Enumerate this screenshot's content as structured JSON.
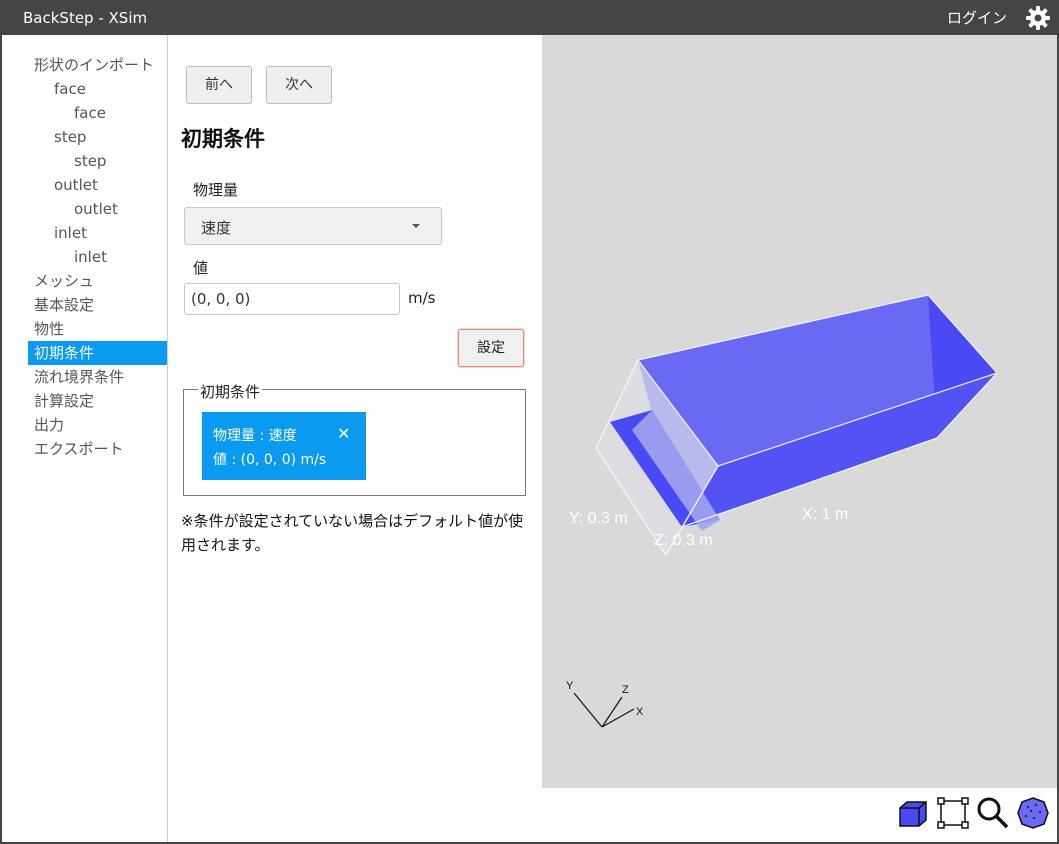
{
  "titlebar": {
    "title": "BackStep - XSim",
    "login": "ログイン"
  },
  "sidebar": {
    "items": [
      {
        "label": "形状のインポート",
        "level": 0,
        "active": false
      },
      {
        "label": "face",
        "level": 1,
        "active": false
      },
      {
        "label": "face",
        "level": 2,
        "active": false
      },
      {
        "label": "step",
        "level": 1,
        "active": false
      },
      {
        "label": "step",
        "level": 2,
        "active": false
      },
      {
        "label": "outlet",
        "level": 1,
        "active": false
      },
      {
        "label": "outlet",
        "level": 2,
        "active": false
      },
      {
        "label": "inlet",
        "level": 1,
        "active": false
      },
      {
        "label": "inlet",
        "level": 2,
        "active": false
      },
      {
        "label": "メッシュ",
        "level": 0,
        "active": false
      },
      {
        "label": "基本設定",
        "level": 0,
        "active": false
      },
      {
        "label": "物性",
        "level": 0,
        "active": false
      },
      {
        "label": "初期条件",
        "level": 0,
        "active": true
      },
      {
        "label": "流れ境界条件",
        "level": 0,
        "active": false
      },
      {
        "label": "計算設定",
        "level": 0,
        "active": false
      },
      {
        "label": "出力",
        "level": 0,
        "active": false
      },
      {
        "label": "エクスポート",
        "level": 0,
        "active": false
      }
    ]
  },
  "panel": {
    "prev": "前へ",
    "next": "次へ",
    "heading": "初期条件",
    "quantity_label": "物理量",
    "quantity_value": "速度",
    "value_label": "値",
    "value_input": "(0, 0, 0)",
    "unit": "m/s",
    "set_button": "設定",
    "list_title": "初期条件",
    "chip_line1": "物理量 : 速度",
    "chip_line2": "値 : (0, 0, 0) m/s",
    "chip_close": "✕",
    "note": "※条件が設定されていない場合はデフォルト値が使用されます。"
  },
  "viewport": {
    "dims": {
      "y": "Y: 0.3 m",
      "z": "Z: 0.3 m",
      "x": "X: 1 m"
    },
    "axes": {
      "x": "X",
      "y": "Y",
      "z": "Z"
    },
    "colors": {
      "background": "#d9d9d9",
      "face": "#4a4af5",
      "selection": "#0a9bf0"
    }
  },
  "toolbar": {
    "icons": [
      "cube-view-icon",
      "fit-selection-icon",
      "zoom-icon",
      "mesh-sphere-icon"
    ]
  }
}
